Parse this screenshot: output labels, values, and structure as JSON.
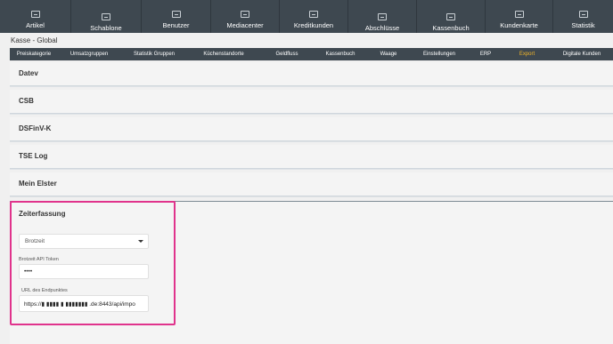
{
  "topnav": {
    "items": [
      {
        "label": "Artikel",
        "icon": "article-icon"
      },
      {
        "label": "Schablone",
        "icon": "template-icon"
      },
      {
        "label": "Benutzer",
        "icon": "users-icon"
      },
      {
        "label": "Mediacenter",
        "icon": "monitor-icon"
      },
      {
        "label": "Kreditkunden",
        "icon": "credit-card-icon"
      },
      {
        "label": "Abschlüsse",
        "icon": "closing-icon"
      },
      {
        "label": "Kassenbuch",
        "icon": "cashbook-icon"
      },
      {
        "label": "Kundenkarte",
        "icon": "customer-card-icon"
      },
      {
        "label": "Statistik",
        "icon": "chart-icon"
      }
    ]
  },
  "page": {
    "title": "Kasse - Global"
  },
  "subnav": {
    "tabs": [
      {
        "label": "Preiskategorie"
      },
      {
        "label": "Umsatzgruppen"
      },
      {
        "label": "Statistik Gruppen"
      },
      {
        "label": "Küchenstandorte"
      },
      {
        "label": "Geldfluss"
      },
      {
        "label": "Kassenbuch"
      },
      {
        "label": "Waage"
      },
      {
        "label": "Einstellungen"
      },
      {
        "label": "ERP"
      },
      {
        "label": "Export"
      },
      {
        "label": "Digitale Kunden"
      }
    ],
    "active": "Export",
    "active_color": "#f0b429"
  },
  "panels": [
    {
      "title": "Datev"
    },
    {
      "title": "CSB"
    },
    {
      "title": "DSFinV-K"
    },
    {
      "title": "TSE Log"
    },
    {
      "title": "Mein Elster"
    }
  ],
  "zeiterfassung": {
    "title": "Zeiterfassung",
    "provider_value": "Brotzeit",
    "token_label": "Brotzeit API Token",
    "token_value": "••••",
    "url_label": "URL des Endpunktes",
    "url_value": "https://▮ ▮▮▮▮ ▮ ▮▮▮▮▮▮▮ .de:8443/api/impo"
  },
  "colors": {
    "nav_bg": "#3e4850",
    "highlight": "#e0338c"
  }
}
